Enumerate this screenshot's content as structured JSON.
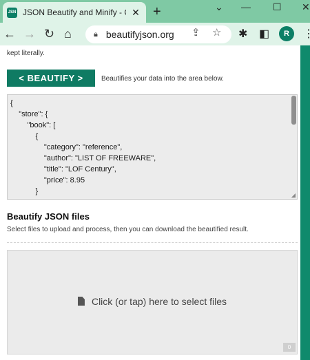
{
  "browser": {
    "tab_title": "JSON Beautify and Minify - O",
    "favicon_text": "JSN",
    "url": "beautifyjson.org",
    "profile_initial": "R",
    "icons": [
      "close-icon",
      "plus-icon",
      "back-icon",
      "forward-icon",
      "reload-icon",
      "home-icon",
      "lock-icon",
      "share-icon",
      "star-icon",
      "extensions-icon",
      "sidepanel-icon",
      "menu-icon"
    ]
  },
  "page": {
    "intro_tail": "kept literally.",
    "beautify_button": "< BEAUTIFY >",
    "beautify_desc": "Beautifies your data into the area below.",
    "editor_lines": [
      "{",
      "    \"store\": {",
      "        \"book\": [",
      "            {",
      "                \"category\": \"reference\",",
      "                \"author\": \"LIST OF FREEWARE\",",
      "                \"title\": \"LOF Century\",",
      "                \"price\": 8.95",
      "            }"
    ],
    "files_heading": "Beautify JSON files",
    "files_desc": "Select files to upload and process, then you can download the beautified result.",
    "dropzone_label": "Click (or tap) here to select files",
    "file_count": "0"
  },
  "colors": {
    "accent": "#0f7b63",
    "tabbar": "#7fc9a4",
    "toolbar": "#dff3e8"
  }
}
